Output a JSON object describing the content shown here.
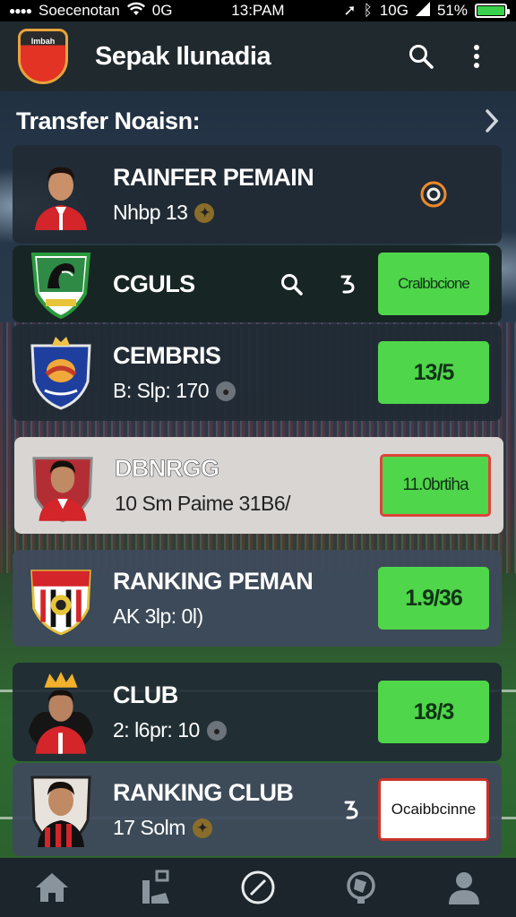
{
  "status_bar": {
    "carrier": "Soecenotan",
    "network": "0G",
    "time": "13:PAM",
    "network_right": "10G",
    "battery": "51%"
  },
  "app": {
    "title": "Sepak Ilunadia",
    "logo_text": "Imbah"
  },
  "section": {
    "title": "Transfer Noaisn:"
  },
  "cards": [
    {
      "name": "RAINFER PEMAIN",
      "sub": "Nhbp 13",
      "style": "default",
      "action_type": "icon",
      "crest": "player"
    },
    {
      "name": "CGULS",
      "sub": "",
      "style": "dark",
      "action_type": "green",
      "action_label": "Cralbbcione",
      "crest": "eagle"
    },
    {
      "name": "CEMBRIS",
      "sub": "B: Slp: 170",
      "style": "default",
      "action_type": "green",
      "action_label": "13/5",
      "crest": "shield"
    },
    {
      "name": "DBNRGG",
      "sub": "10 Sm Paime 31B6/",
      "style": "light",
      "action_type": "green-outlined",
      "action_label": "11.0brtiha",
      "crest": "player"
    },
    {
      "name": "RANKING PEMAN",
      "sub": "AK 3lp: 0l)",
      "style": "slate",
      "action_type": "green",
      "action_label": "1.9/36",
      "crest": "club"
    },
    {
      "name": "CLUB",
      "sub": "2: l6pr: 10",
      "style": "default",
      "action_type": "green",
      "action_label": "18/3",
      "crest": "player-crown"
    },
    {
      "name": "RANKING CLUB",
      "sub": "17 Solm",
      "style": "slate",
      "action_type": "white",
      "action_label": "Ocaibbcinne",
      "crest": "player"
    }
  ],
  "nav": [
    {
      "icon": "home-icon"
    },
    {
      "icon": "stats-icon"
    },
    {
      "icon": "compass-icon"
    },
    {
      "icon": "ball-icon"
    },
    {
      "icon": "profile-icon"
    }
  ],
  "colors": {
    "accent_green": "#4fd64a",
    "appbar": "#20292e",
    "battery_green": "#39d14b",
    "alert_red": "#e0433a"
  }
}
